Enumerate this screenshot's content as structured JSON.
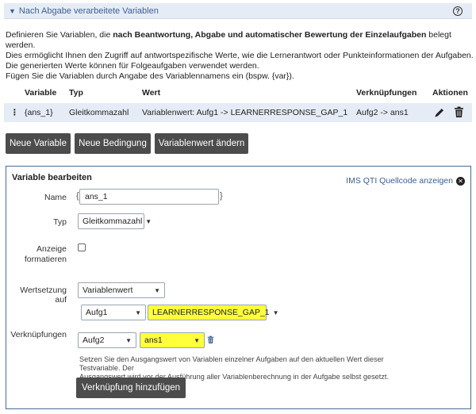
{
  "section": {
    "toggle_glyph": "▼",
    "title": "Nach Abgabe verarbeitete Variablen",
    "help_glyph": "?"
  },
  "intro": {
    "line1_pre": "Definieren Sie Variablen, die ",
    "line1_bold": "nach Beantwortung, Abgabe und automatischer Bewertung der Einzelaufgaben",
    "line1_post": " belegt werden.",
    "line2": "Dies ermöglicht Ihnen den Zugriff auf antwortspezifische Werte, wie die Lernerantwort oder Punkteinformationen der Aufgaben.",
    "line3": "Die generierten Werte können für Folgeaufgaben verwendet werden.",
    "line4": "Fügen Sie die Variablen durch Angabe des Variablennamens ein (bspw. {var})."
  },
  "table": {
    "headers": {
      "variable": "Variable",
      "typ": "Typ",
      "wert": "Wert",
      "verknuepfungen": "Verknüpfungen",
      "aktionen": "Aktionen"
    },
    "row": {
      "handle": "⋮",
      "variable": "{ans_1}",
      "typ": "Gleitkommazahl",
      "wert": "Variablenwert: Aufg1 -> LEARNERRESPONSE_GAP_1",
      "verknuepfungen": "Aufg2 -> ans1"
    }
  },
  "buttons": {
    "neue_variable": "Neue Variable",
    "neue_bedingung": "Neue Bedingung",
    "variablenwert_aendern": "Variablenwert ändern"
  },
  "editor": {
    "title": "Variable bearbeiten",
    "qti_link": "IMS QTI Quellcode anzeigen",
    "close_glyph": "✕",
    "name_label": "Name",
    "brace_open": "{",
    "brace_close": "}",
    "name_value": "ans_1",
    "typ_label": "Typ",
    "typ_value": "Gleitkommazahl",
    "anzeige_label_1": "Anzeige",
    "anzeige_label_2": "formatieren",
    "wertsetzung_label": "Wertsetzung auf",
    "wertsetzung_value": "Variablenwert",
    "aufgabe_value": "Aufg1",
    "response_value": "LEARNERRESPONSE_GAP_1",
    "verknuepfungen_label": "Verknüpfungen",
    "link_aufgabe_value": "Aufg2",
    "link_variable_value": "ans1",
    "help_line1": "Setzen Sie den Ausgangswert von Variablen einzelner Aufgaben auf den aktuellen Wert dieser Testvariable. Der",
    "help_line2": "Ausgangswert wird vor der Ausführung aller Variablenberechnung in der Aufgabe selbst gesetzt.",
    "add_link_button": "Verknüpfung hinzufügen"
  },
  "colors": {
    "accent": "#3b5f94",
    "header_bg": "#e6ecf5",
    "button_bg": "#4c4c4c",
    "highlight": "#ffff3c"
  }
}
